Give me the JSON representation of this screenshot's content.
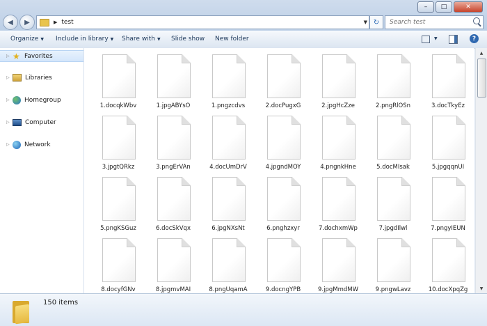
{
  "window": {
    "minimize": "–",
    "maximize": "□",
    "close": "✕"
  },
  "nav": {
    "back": "◀",
    "forward": "▶",
    "dropdown": "▼"
  },
  "address": {
    "crumbs": [
      "test"
    ],
    "arrow": "▶",
    "dropdown": "▼"
  },
  "search": {
    "placeholder": "Search test"
  },
  "toolbar": {
    "organize": "Organize",
    "include_in_library": "Include in library",
    "share_with": "Share with",
    "slide_show": "Slide show",
    "new_folder": "New folder",
    "caret": "▼",
    "help": "?"
  },
  "navpane": {
    "items": [
      {
        "label": "Favorites",
        "icon": "star-icon"
      },
      {
        "label": "Libraries",
        "icon": "library-icon"
      },
      {
        "label": "Homegroup",
        "icon": "homegroup-icon"
      },
      {
        "label": "Computer",
        "icon": "computer-icon"
      },
      {
        "label": "Network",
        "icon": "network-icon"
      }
    ],
    "expander": "▷"
  },
  "files": [
    "1.docqkWbv",
    "1.jpgABYsO",
    "1.pngzcdvs",
    "2.docPugxG",
    "2.jpgHcZze",
    "2.pngRlOSn",
    "3.docTkyEz",
    "3.jpgtQRkz",
    "3.pngErVAn",
    "4.docUmDrV",
    "4.jpgndMOY",
    "4.pngnkHne",
    "5.docMIsak",
    "5.jpgqqnUI",
    "5.pngKSGuz",
    "6.docSkVqx",
    "6.jpgNXsNt",
    "6.pnghzxyr",
    "7.dochxmWp",
    "7.jpgdIlwl",
    "7.pngyIEUN",
    "8.docyfGNv",
    "8.jpgmvMAI",
    "8.pngUqamA",
    "9.docngYPB",
    "9.jpgMmdMW",
    "9.pngwLavz",
    "10.docXpqZg"
  ],
  "scrollbar": {
    "up": "▲",
    "down": "▼"
  },
  "details": {
    "count": "150 items"
  }
}
